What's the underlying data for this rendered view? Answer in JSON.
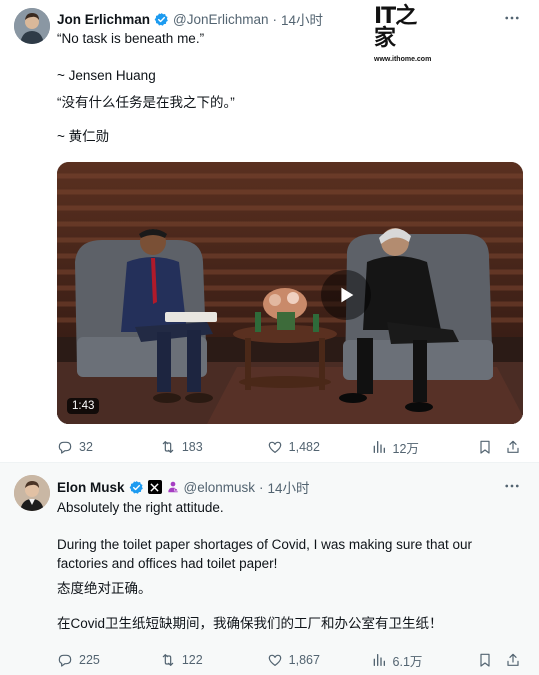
{
  "post1": {
    "author_name": "Jon Erlichman",
    "handle": "@JonErlichman",
    "dot": "·",
    "time": "14小时",
    "lines": [
      "“No task is beneath me.”",
      "~ Jensen Huang",
      "“没有什么任务是在我之下的。”",
      "~ 黄仁勋"
    ],
    "video_duration": "1:43",
    "stats": {
      "replies": "32",
      "reposts": "183",
      "likes": "1,482",
      "views": "12万"
    }
  },
  "watermark": {
    "mark": "IT之家",
    "url": "www.ithome.com"
  },
  "post2": {
    "author_name": "Elon Musk",
    "handle": "@elonmusk",
    "dot": "·",
    "time": "14小时",
    "lines": [
      "Absolutely the right attitude.",
      "During the toilet paper shortages of Covid, I was making sure that our",
      "factories and offices had toilet paper!",
      "态度绝对正确。",
      "在Covid卫生纸短缺期间，我确保我们的工厂和办公室有卫生纸！"
    ],
    "stats": {
      "replies": "225",
      "reposts": "122",
      "likes": "1,867",
      "views": "6.1万"
    }
  },
  "colors": {
    "verified": "#1d9bf0",
    "text": "#0f1419",
    "muted": "#536471",
    "badge_x": "#000000",
    "badge_person": "#a53ec2"
  },
  "icons": [
    "verified-icon",
    "x-badge-icon",
    "person-badge-icon",
    "more-icon",
    "play-icon",
    "reply-icon",
    "repost-icon",
    "like-icon",
    "views-icon",
    "bookmark-icon",
    "share-icon"
  ]
}
